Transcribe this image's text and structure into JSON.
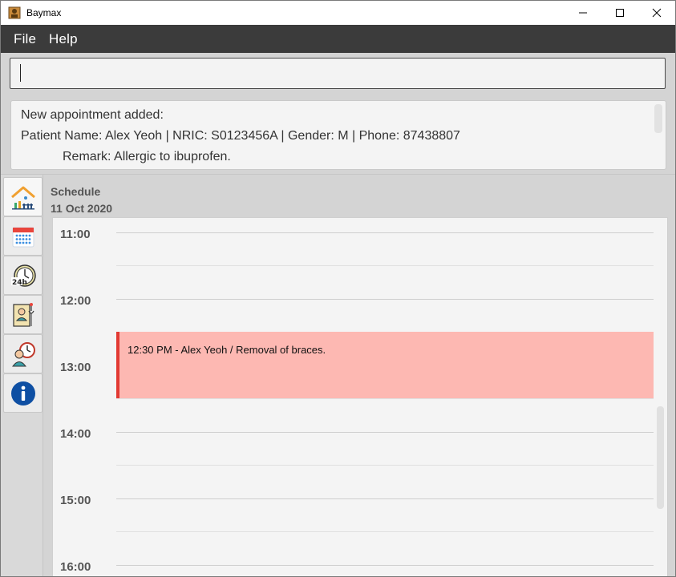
{
  "window": {
    "title": "Baymax"
  },
  "menu": {
    "items": [
      "File",
      "Help"
    ]
  },
  "command": {
    "value": ""
  },
  "result": {
    "lines": [
      "New appointment added:",
      "Patient Name: Alex Yeoh | NRIC: S0123456A | Gender: M | Phone: 87438807",
      "Remark: Allergic to ibuprofen."
    ]
  },
  "sidebar": {
    "tabs": [
      {
        "name": "home-icon",
        "active": true
      },
      {
        "name": "calendar-icon"
      },
      {
        "name": "clock-24h-icon"
      },
      {
        "name": "patient-record-icon"
      },
      {
        "name": "doctor-clock-icon"
      },
      {
        "name": "info-icon"
      }
    ]
  },
  "schedule": {
    "title": "Schedule",
    "date": "11 Oct 2020",
    "times": [
      "11:00",
      "12:00",
      "13:00",
      "14:00",
      "15:00",
      "16:00"
    ],
    "appointment": {
      "text": "12:30 PM - Alex Yeoh / Removal of braces.",
      "color": "#fdb8b2",
      "accent": "#e23a33"
    }
  }
}
